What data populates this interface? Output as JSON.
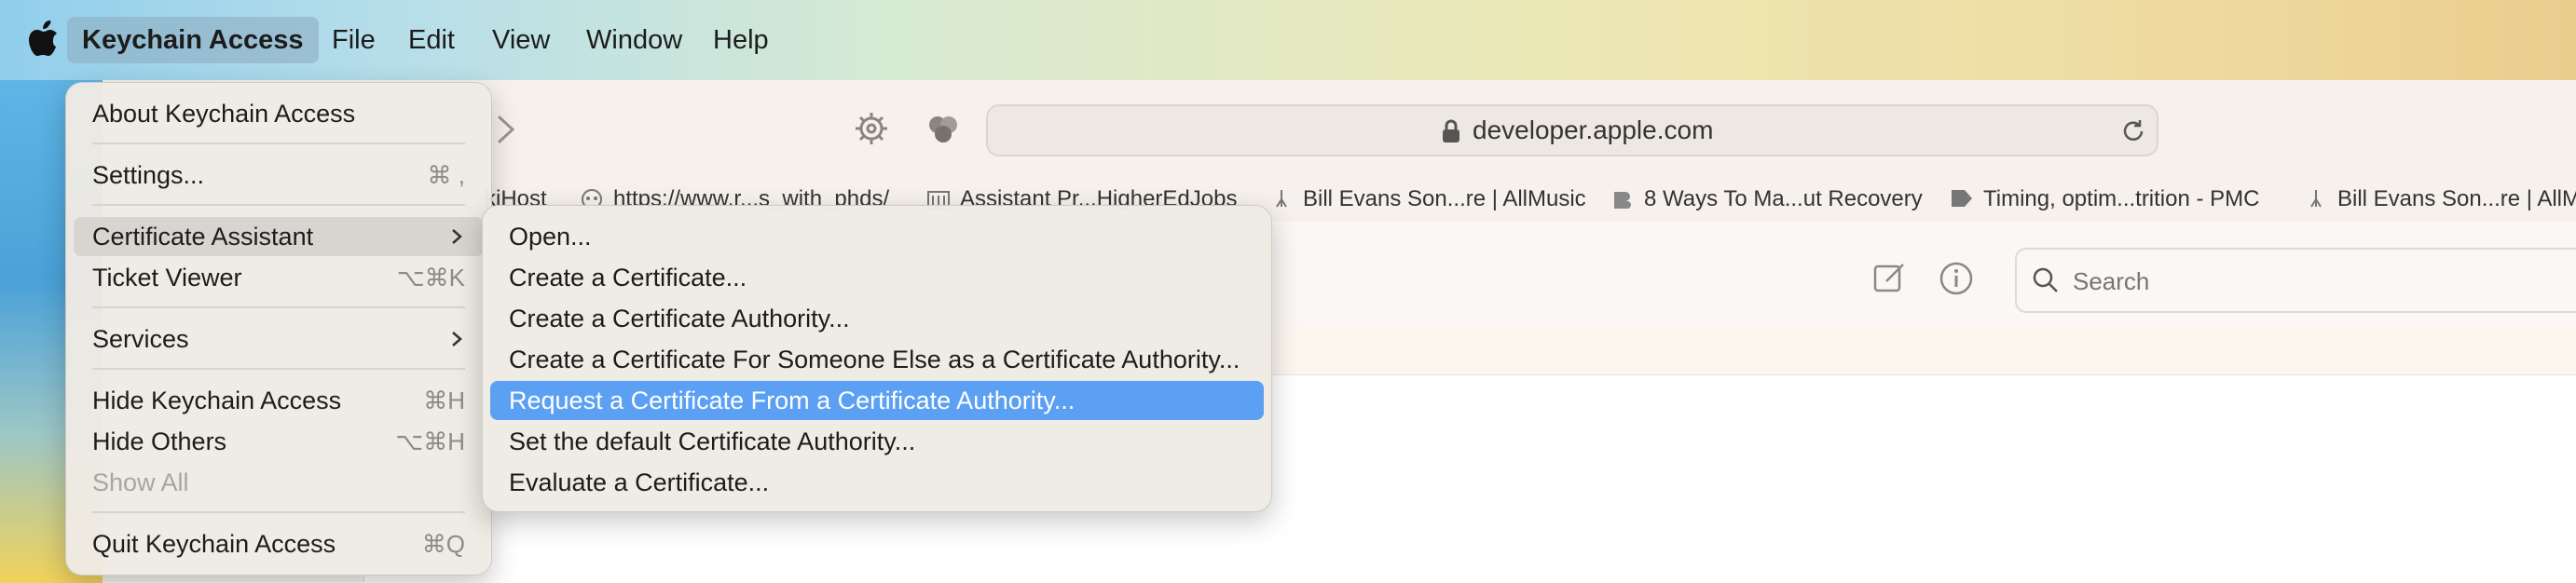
{
  "menubar": {
    "app": "Keychain Access",
    "items": [
      "File",
      "Edit",
      "View",
      "Window",
      "Help"
    ]
  },
  "safari": {
    "address": "developer.apple.com",
    "search_placeholder": "Search",
    "bookmarks": [
      "kiHost",
      "https://www.r...s_with_phds/",
      "Assistant Pr...HigherEdJobs",
      "Bill Evans Son...re | AllMusic",
      "8 Ways To Ma...ut Recovery",
      "Timing, optim...trition - PMC",
      "Bill Evans Son...re | AllMu"
    ]
  },
  "app_menu": {
    "about": "About Keychain Access",
    "settings": "Settings...",
    "settings_sc": "⌘ ,",
    "cert_assistant": "Certificate Assistant",
    "ticket_viewer": "Ticket Viewer",
    "ticket_viewer_sc": "⌥⌘K",
    "services": "Services",
    "hide": "Hide Keychain Access",
    "hide_sc": "⌘H",
    "hide_others": "Hide Others",
    "hide_others_sc": "⌥⌘H",
    "show_all": "Show All",
    "quit": "Quit Keychain Access",
    "quit_sc": "⌘Q"
  },
  "cert_menu": {
    "open": "Open...",
    "create_cert": "Create a Certificate...",
    "create_ca": "Create a Certificate Authority...",
    "create_for_other": "Create a Certificate For Someone Else as a Certificate Authority...",
    "request": "Request a Certificate From a Certificate Authority...",
    "set_default": "Set the default Certificate Authority...",
    "evaluate": "Evaluate a Certificate..."
  },
  "colors": {
    "selection": "#5ba0f2",
    "menu_bg": "#eeeae4"
  }
}
